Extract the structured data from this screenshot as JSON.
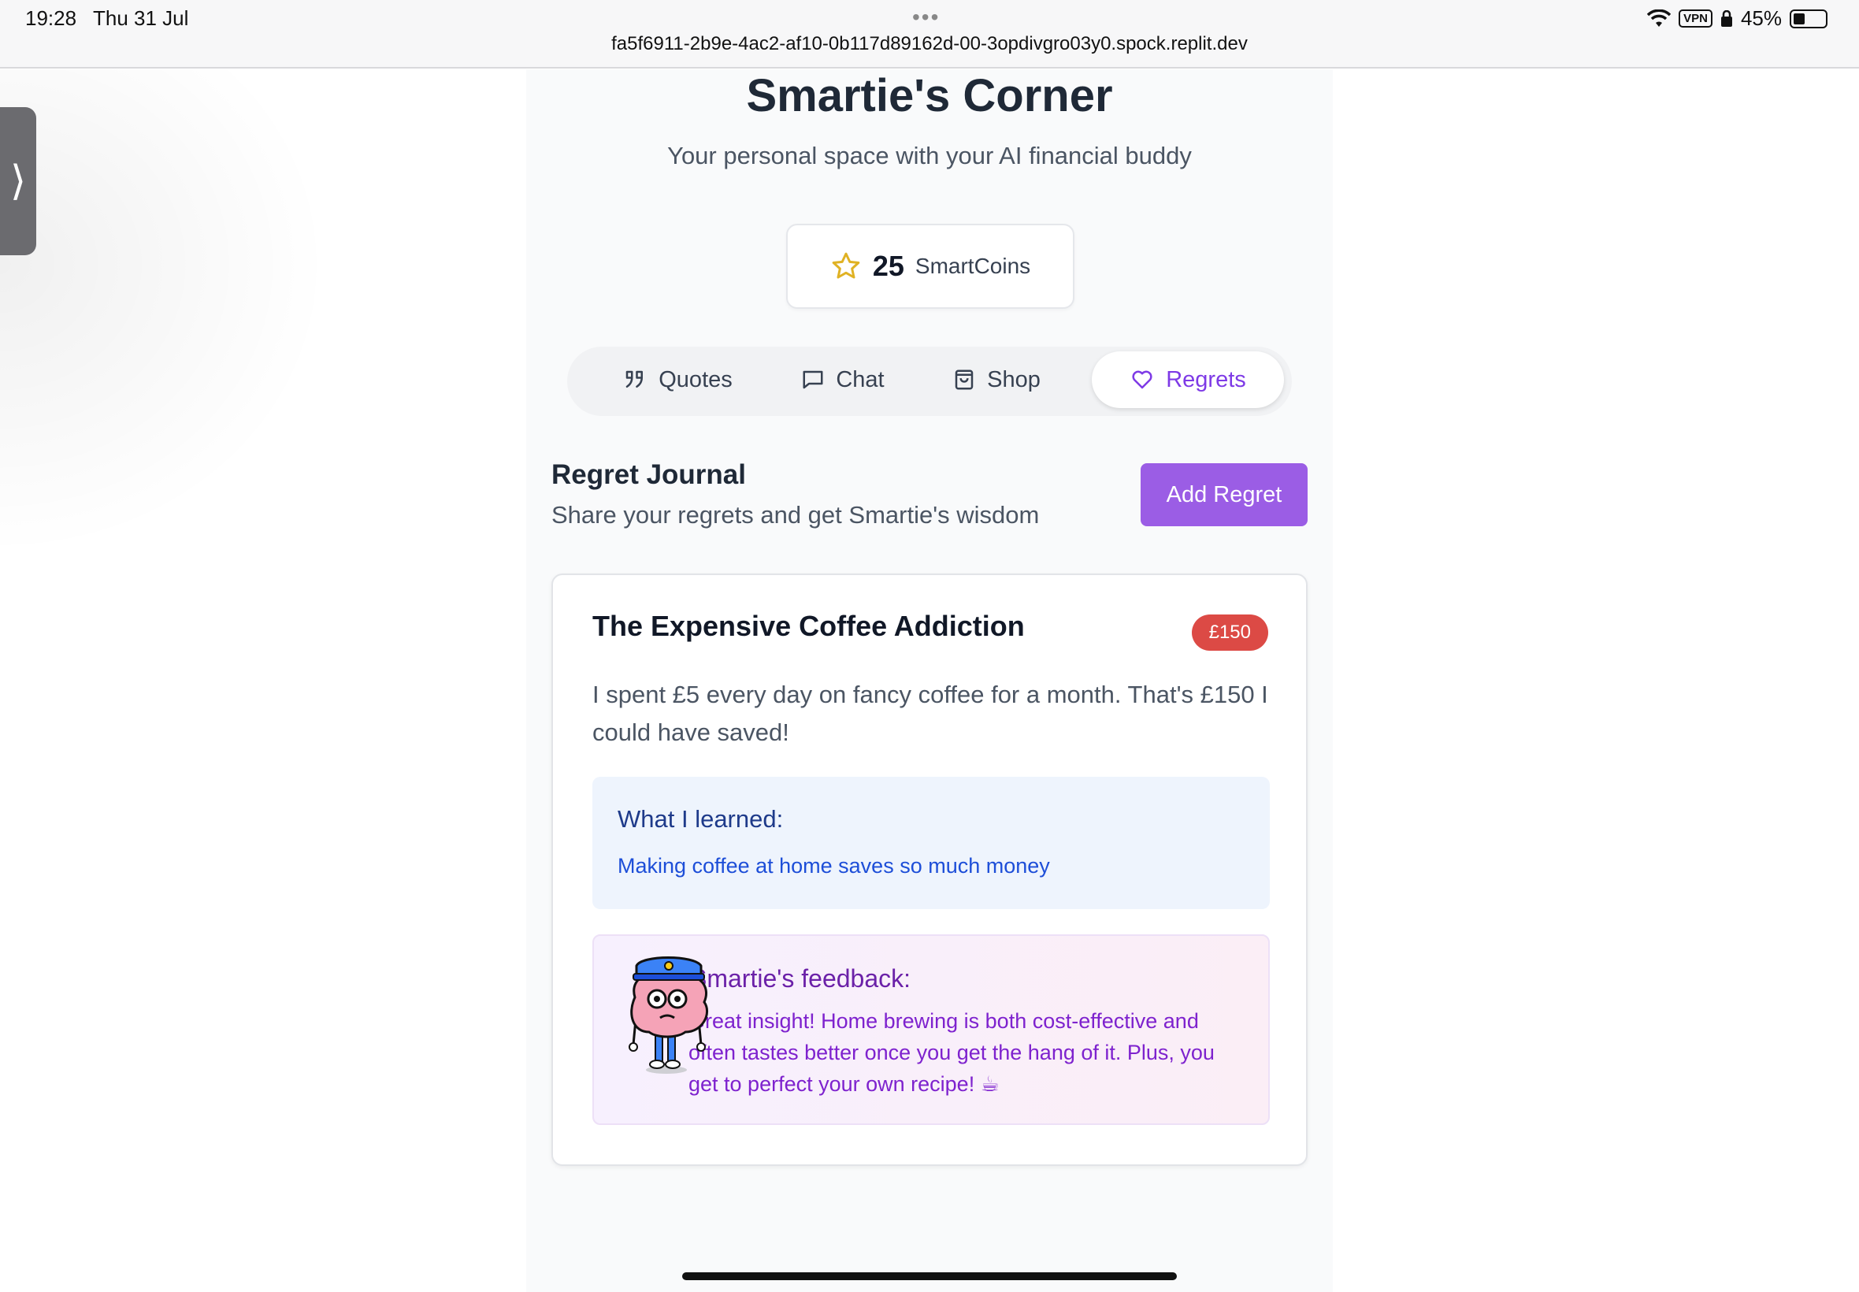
{
  "status_bar": {
    "time": "19:28",
    "date": "Thu 31 Jul",
    "url": "fa5f6911-2b9e-4ac2-af10-0b117d89162d-00-3opdivgro03y0.spock.replit.dev",
    "vpn": "VPN",
    "battery": "45%"
  },
  "header": {
    "title": "Smartie's Corner",
    "subtitle": "Your personal space with your AI financial buddy"
  },
  "coins": {
    "amount": "25",
    "label": "SmartCoins"
  },
  "tabs": [
    {
      "label": "Quotes",
      "icon": "quote-icon",
      "active": false
    },
    {
      "label": "Chat",
      "icon": "chat-icon",
      "active": false
    },
    {
      "label": "Shop",
      "icon": "shopping-bag-icon",
      "active": false
    },
    {
      "label": "Regrets",
      "icon": "heart-icon",
      "active": true
    }
  ],
  "journal": {
    "title": "Regret Journal",
    "subtitle": "Share your regrets and get Smartie's wisdom",
    "add_button": "Add Regret"
  },
  "regret": {
    "title": "The Expensive Coffee Addiction",
    "amount": "£150",
    "description": "I spent £5 every day on fancy coffee for a month. That's £150 I could have saved!",
    "learned_heading": "What I learned:",
    "learned_text": "Making coffee at home saves so much money",
    "feedback_heading": "Smartie's feedback:",
    "feedback_text": "Great insight! Home brewing is both cost-effective and often tastes better once you get the hang of it. Plus, you get to perfect your own recipe! ☕"
  },
  "colors": {
    "accent_purple": "#9b5de5",
    "active_tab_text": "#7e3ae6",
    "amount_badge": "#dc4a45",
    "star": "#e0b224"
  }
}
